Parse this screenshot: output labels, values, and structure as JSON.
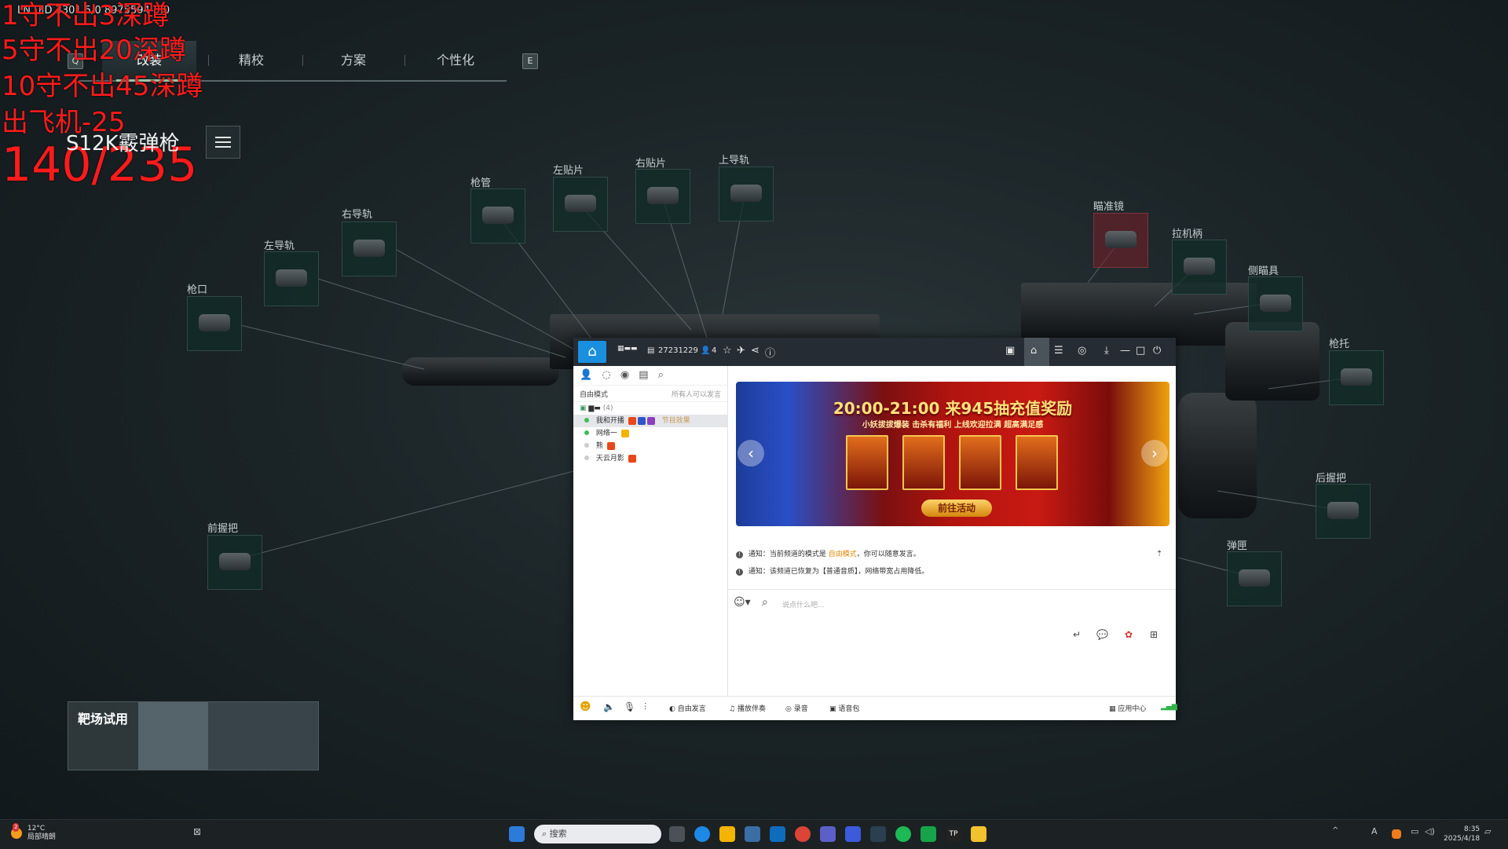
{
  "tabs": {
    "key_left": "Q",
    "items": [
      "改装",
      "精校",
      "方案",
      "个性化"
    ],
    "key_right": "E"
  },
  "overlay": {
    "id_line": "LN UID 3301 5/0 8975594-5.0",
    "lines": [
      "1守不出3深蹲",
      "5守不出20深蹲",
      "10守不出45深蹲",
      "出飞机-25"
    ],
    "score": "140/235"
  },
  "weapon": {
    "name": "S12K霰弹枪"
  },
  "slots": {
    "muzzle": "枪口",
    "left_rail": "左导轨",
    "right_rail": "右导轨",
    "barrel": "枪管",
    "left_patch": "左贴片",
    "right_patch": "右贴片",
    "top_rail": "上导轨",
    "scope": "瞄准镜",
    "charging_handle": "拉机柄",
    "side_scope": "侧瞄具",
    "stock": "枪托",
    "rear_grip": "后握把",
    "magazine": "弹匣",
    "fore_grip": "前握把"
  },
  "range_trial": {
    "label": "靶场试用"
  },
  "yy": {
    "channel_id": "27231229",
    "online_count": "4",
    "mode_label": "自由模式",
    "mode_hint": "所有人可以发言",
    "channel_count": "(4)",
    "members": [
      "我和开播",
      "网络一",
      "熊",
      "天云月影"
    ],
    "member_tag": "节目效果",
    "banner": {
      "title": "20:00-21:00 来945抽充值奖励",
      "subtitle": "小妖拔拔爆装 击杀有福利 上线欢迎拉满 超高满足感",
      "button": "前往活动"
    },
    "notices": [
      {
        "prefix": "通知：",
        "text": "当前频道的模式是 ",
        "hl": "自由模式",
        "suffix": "，你可以随意发言。"
      },
      {
        "prefix": "通知：",
        "text": "该频道已恢复为【普通音质】，网络带宽占用降低。",
        "hl": "",
        "suffix": ""
      }
    ],
    "input_placeholder": "说点什么吧...",
    "bottom": {
      "free_speak": "自由发言",
      "music": "播放伴奏",
      "record": "录音",
      "voice_pack": "语音包",
      "app_center": "应用中心"
    }
  },
  "taskbar": {
    "weather_temp": "12°C",
    "weather_desc": "局部晴朗",
    "search_placeholder": "搜索",
    "time": "8:35",
    "date": "2025/4/18",
    "notif_count": "2"
  }
}
